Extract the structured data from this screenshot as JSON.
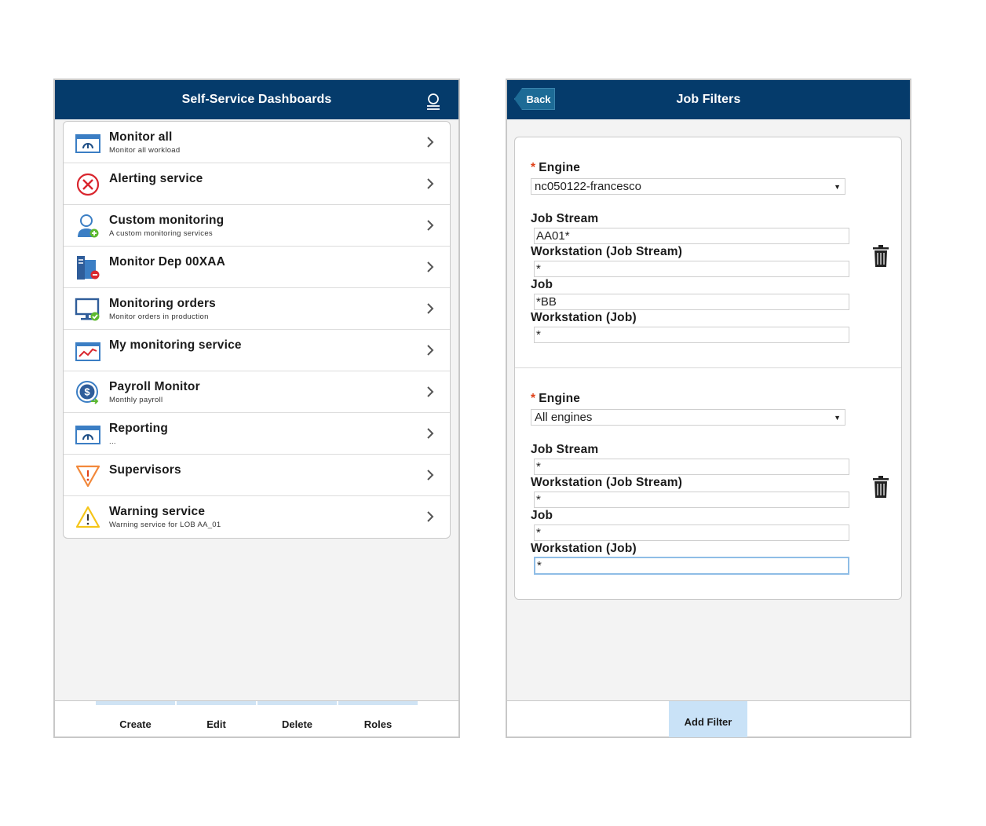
{
  "left": {
    "header_title": "Self-Service Dashboards",
    "items": [
      {
        "title": "Monitor all",
        "subtitle": "Monitor all workload",
        "icon": "dashboard-gauge-icon"
      },
      {
        "title": "Alerting service",
        "subtitle": "",
        "icon": "error-circle-icon"
      },
      {
        "title": "Custom monitoring",
        "subtitle": "A custom monitoring services",
        "icon": "user-add-icon"
      },
      {
        "title": "Monitor Dep 00XAA",
        "subtitle": "",
        "icon": "server-error-icon"
      },
      {
        "title": "Monitoring orders",
        "subtitle": "Monitor orders in production",
        "icon": "monitor-check-icon"
      },
      {
        "title": "My monitoring service",
        "subtitle": "",
        "icon": "trend-chart-icon"
      },
      {
        "title": "Payroll Monitor",
        "subtitle": "Monthly payroll",
        "icon": "dollar-coin-icon"
      },
      {
        "title": "Reporting",
        "subtitle": "...",
        "icon": "dashboard-gauge-icon"
      },
      {
        "title": "Supervisors",
        "subtitle": "",
        "icon": "warning-inverted-triangle-icon"
      },
      {
        "title": "Warning service",
        "subtitle": "Warning service for LOB AA_01",
        "icon": "warning-triangle-icon"
      }
    ],
    "footer_tabs": [
      "Create",
      "Edit",
      "Delete",
      "Roles"
    ]
  },
  "right": {
    "header_title": "Job Filters",
    "back_label": "Back",
    "filters": [
      {
        "engine_label": "Engine",
        "engine_value": "nc050122-francesco",
        "job_stream_label": "Job Stream",
        "job_stream_value": "AA01*",
        "ws_job_stream_label": "Workstation (Job Stream)",
        "ws_job_stream_value": "*",
        "job_label": "Job",
        "job_value": "*BB",
        "ws_job_label": "Workstation (Job)",
        "ws_job_value": "*"
      },
      {
        "engine_label": "Engine",
        "engine_value": "All engines",
        "job_stream_label": "Job Stream",
        "job_stream_value": "*",
        "ws_job_stream_label": "Workstation (Job Stream)",
        "ws_job_stream_value": "*",
        "job_label": "Job",
        "job_value": "*",
        "ws_job_label": "Workstation (Job)",
        "ws_job_value": "*"
      }
    ],
    "required_mark": "*",
    "add_filter_label": "Add Filter"
  },
  "colors": {
    "header_bg": "#053b6b",
    "tab_highlight": "#cfe3f4",
    "required": "#e0421a"
  }
}
